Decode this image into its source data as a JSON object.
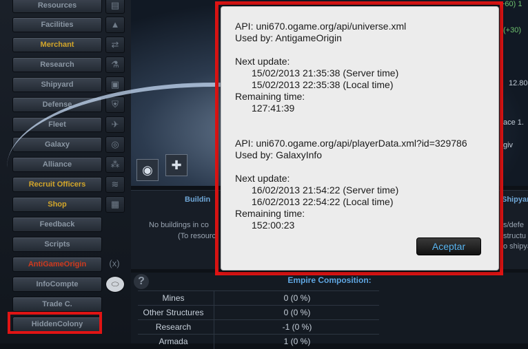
{
  "menu": {
    "items": [
      {
        "label": "Resources",
        "style": "normal"
      },
      {
        "label": "Facilities",
        "style": "normal"
      },
      {
        "label": "Merchant",
        "style": "gold"
      },
      {
        "label": "Research",
        "style": "normal"
      },
      {
        "label": "Shipyard",
        "style": "normal"
      },
      {
        "label": "Defense",
        "style": "normal"
      },
      {
        "label": "Fleet",
        "style": "normal"
      },
      {
        "label": "Galaxy",
        "style": "normal"
      },
      {
        "label": "Alliance",
        "style": "normal"
      },
      {
        "label": "Recruit Officers",
        "style": "gold"
      },
      {
        "label": "Shop",
        "style": "gold"
      },
      {
        "label": "Feedback",
        "style": "normal"
      },
      {
        "label": "Scripts",
        "style": "normal"
      },
      {
        "label": "AntiGameOrigin",
        "style": "red"
      },
      {
        "label": "InfoCompte",
        "style": "normal"
      },
      {
        "label": "Trade C.",
        "style": "normal"
      },
      {
        "label": "HiddenColony",
        "style": "normal"
      }
    ],
    "antigame_badge": "(x)"
  },
  "background": {
    "top_right_1": "+60) 1",
    "top_right_2": "(+30)",
    "right_value": "12.80",
    "right_space": "ace 1.",
    "right_give": "giv",
    "buildings_header": "Buildin",
    "shipyard_header": "Shipyard",
    "no_buildings": "No buildings in co",
    "to_resources": "(To resourc",
    "right_defences": "s/defe",
    "right_structures": "structu",
    "right_shipyard": "o shipya"
  },
  "empire": {
    "title": "Empire Composition:",
    "rows": [
      {
        "label": "Mines",
        "value": "0 (0 %)"
      },
      {
        "label": "Other Structures",
        "value": "0 (0 %)"
      },
      {
        "label": "Research",
        "value": "-1 (0 %)"
      },
      {
        "label": "Armada",
        "value": "1 (0 %)"
      }
    ]
  },
  "modal": {
    "api1": "API: uni670.ogame.org/api/universe.xml",
    "used1": "Used by: AntigameOrigin",
    "next1": "Next update:",
    "server1": "15/02/2013 21:35:38 (Server time)",
    "local1": "15/02/2013 22:35:38 (Local time)",
    "remaining_label1": "Remaining time:",
    "remaining1": "127:41:39",
    "api2": "API: uni670.ogame.org/api/playerData.xml?id=329786",
    "used2": "Used by: GalaxyInfo",
    "next2": "Next update:",
    "server2": "16/02/2013 21:54:22 (Server time)",
    "local2": "16/02/2013 22:54:22 (Local time)",
    "remaining_label2": "Remaining time:",
    "remaining2": "152:00:23",
    "accept_label": "Aceptar"
  },
  "colors": {
    "highlight": "#e01414",
    "gold": "#d2a52a",
    "accent_blue": "#58b4f0"
  }
}
